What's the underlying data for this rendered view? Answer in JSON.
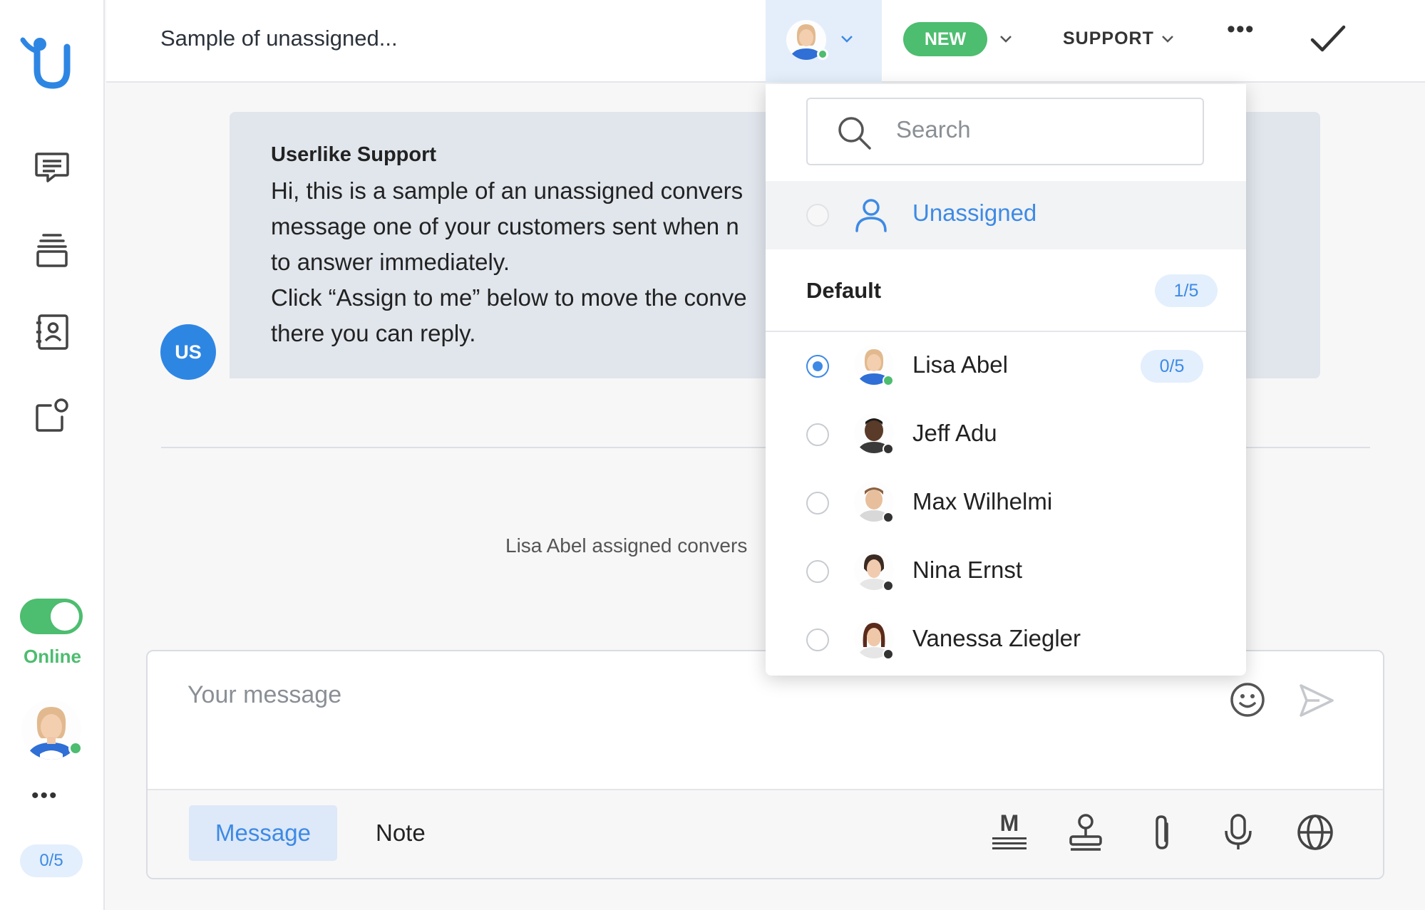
{
  "colors": {
    "accent": "#3d8ae5",
    "online": "#4dbd6f",
    "offline": "#333333",
    "badge_bg": "#e3effc"
  },
  "sidebar": {
    "nav_icons": [
      "chat-icon",
      "stack-icon",
      "contacts-icon",
      "notification-icon"
    ],
    "status_label": "Online",
    "status_on": true,
    "more": "•••",
    "chat_count": "0/5"
  },
  "header": {
    "title": "Sample of unassigned...",
    "status": "NEW",
    "group": "SUPPORT",
    "more": "•••"
  },
  "message": {
    "initials": "US",
    "author": "Userlike Support",
    "lines": [
      "Hi, this is a sample of an unassigned convers",
      "message one of your customers sent when n",
      "to answer immediately.",
      "Click “Assign to me” below to move the conve",
      "there you can reply."
    ]
  },
  "system_message": "Lisa Abel assigned convers",
  "composer": {
    "placeholder": "Your message",
    "tab_message": "Message",
    "tab_note": "Note",
    "markdown_label": "M"
  },
  "dropdown": {
    "search_placeholder": "Search",
    "unassigned_label": "Unassigned",
    "group_name": "Default",
    "group_count": "1/5",
    "agents": [
      {
        "name": "Lisa Abel",
        "selected": true,
        "status": "online",
        "count": "0/5"
      },
      {
        "name": "Jeff Adu",
        "selected": false,
        "status": "offline"
      },
      {
        "name": "Max Wilhelmi",
        "selected": false,
        "status": "offline"
      },
      {
        "name": "Nina Ernst",
        "selected": false,
        "status": "offline"
      },
      {
        "name": "Vanessa Ziegler",
        "selected": false,
        "status": "offline"
      }
    ]
  }
}
